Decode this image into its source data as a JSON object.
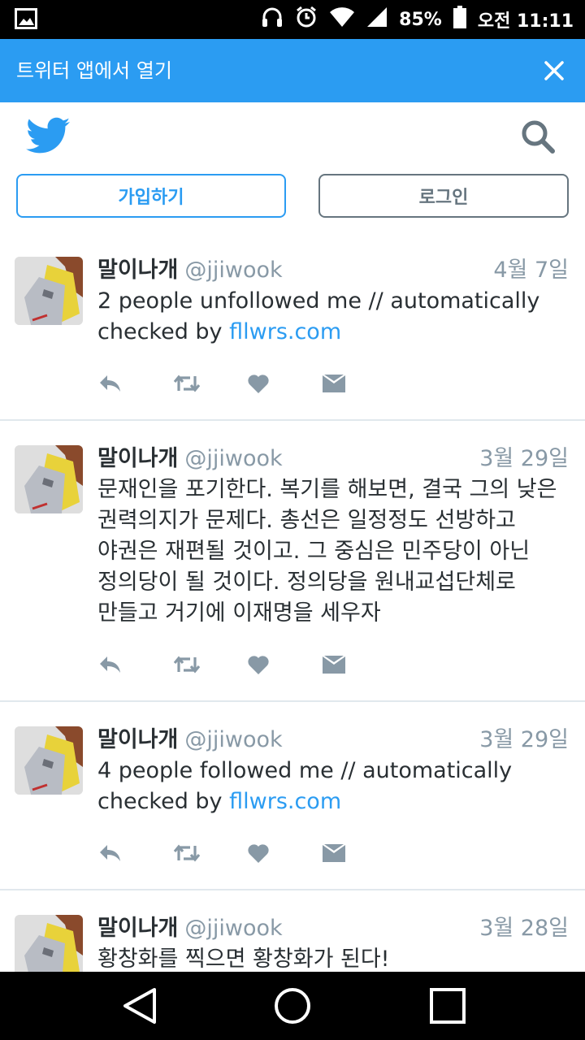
{
  "status_bar": {
    "battery": "85%",
    "time": "오전 11:11",
    "icons": [
      "image-icon",
      "headphones-icon",
      "alarm-icon",
      "wifi-icon",
      "signal-icon",
      "battery-icon"
    ]
  },
  "banner": {
    "text": "트위터 앱에서 열기",
    "close_icon": "close-icon",
    "background": "#2b9cf2"
  },
  "header": {
    "logo_icon": "twitter-bird-icon",
    "search_icon": "search-icon",
    "signup_label": "가입하기",
    "login_label": "로그인",
    "accent": "#2b9cf2"
  },
  "tweets": [
    {
      "name": "말이나개",
      "handle": "@jjiwook",
      "date": "4월 7일",
      "text": "2 people unfollowed me // automatically checked by ",
      "link": "fllwrs.com"
    },
    {
      "name": "말이나개",
      "handle": "@jjiwook",
      "date": "3월 29일",
      "text": "문재인을 포기한다. 복기를 해보면, 결국 그의 낮은 권력의지가 문제다. 총선은 일정정도 선방하고 야권은 재편될 것이고. 그 중심은 민주당이 아닌 정의당이 될 것이다. 정의당을 원내교섭단체로 만들고 거기에 이재명을 세우자",
      "link": ""
    },
    {
      "name": "말이나개",
      "handle": "@jjiwook",
      "date": "3월 29일",
      "text": "4 people followed me // automatically checked by ",
      "link": "fllwrs.com"
    },
    {
      "name": "말이나개",
      "handle": "@jjiwook",
      "date": "3월 28일",
      "text": "황창화를 찍으면 황창화가 된다!",
      "link": ""
    }
  ],
  "tweet_actions": [
    "reply-icon",
    "retweet-icon",
    "like-icon",
    "message-icon"
  ],
  "nav_bar": [
    "back-icon",
    "home-icon",
    "recents-icon"
  ]
}
